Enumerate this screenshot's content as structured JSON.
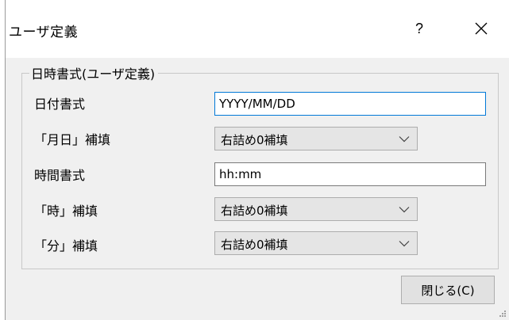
{
  "dialog": {
    "title": "ユーザ定義",
    "help_label": "?",
    "close_icon": "close-icon",
    "group_label": "日時書式(ユーザ定義)",
    "fields": [
      {
        "label": "日付書式",
        "type": "text",
        "value": "YYYY/MM/DD",
        "focused": true
      },
      {
        "label": "「月日」補填",
        "type": "select",
        "value": "右詰め0補填",
        "icon": "chevron-down-icon"
      },
      {
        "label": "時間書式",
        "type": "text",
        "value": "hh:mm"
      },
      {
        "label": "「時」補填",
        "type": "select",
        "value": "右詰め0補填",
        "icon": "chevron-down-icon"
      },
      {
        "label": "「分」補填",
        "type": "select",
        "value": "右詰め0補填",
        "icon": "chevron-down-icon"
      }
    ],
    "close_button_label": "閉じる(C)",
    "colors": {
      "focus_border": "#0078d7",
      "dialog_bg": "#f0f0f0",
      "titlebar_bg": "#ffffff",
      "select_bg": "#e5e5e5",
      "button_bg": "#e1e1e1"
    }
  }
}
